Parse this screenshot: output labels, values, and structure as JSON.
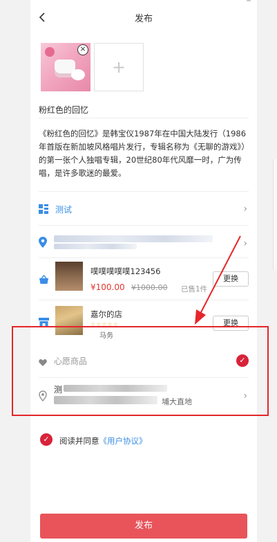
{
  "header": {
    "back_icon": "chevron-left-icon",
    "title": "发布"
  },
  "photos": {
    "close_icon": "close-circle-icon",
    "add_icon": "plus-icon",
    "add_symbol": "+",
    "close_symbol": "×"
  },
  "item": {
    "title": "粉红色的回忆",
    "description": "《粉红色的回忆》是韩宝仪1987年在中国大陆发行（1986年首版在新加坡风格唱片发行，专辑名称为《无聊的游戏》）的第一张个人独唱专辑，20世纪80年代风靡一时，广为传唱，是许多歌迷的最爱。"
  },
  "topic": {
    "icon": "grid-icon",
    "label": "测试",
    "color": "#3a8ee6"
  },
  "location": {
    "icon": "location-pin-icon"
  },
  "product": {
    "icon": "shopping-basket-icon",
    "name": "噗噗噗噗噗123456",
    "price": "¥100.00",
    "original_price": "¥1000.00",
    "sold": "已售1件",
    "change_label": "更换"
  },
  "shop": {
    "icon": "store-icon",
    "name": "嘉尔的店",
    "stars": "☆☆☆☆☆",
    "sub": "马务",
    "change_label": "更换"
  },
  "wish": {
    "icon": "heart-icon",
    "label": "心愿商品",
    "check_icon": "check-circle-icon",
    "check_symbol": "✓"
  },
  "address": {
    "icon": "location-outline-icon",
    "visible_char": "测",
    "partial_text": "埔大直地"
  },
  "agreement": {
    "check_symbol": "✓",
    "prefix": "阅读并同意",
    "link": "《用户协议》"
  },
  "publish": {
    "label": "发布",
    "color": "#e8545a"
  },
  "annotation": {
    "box_color": "#e5262b"
  }
}
